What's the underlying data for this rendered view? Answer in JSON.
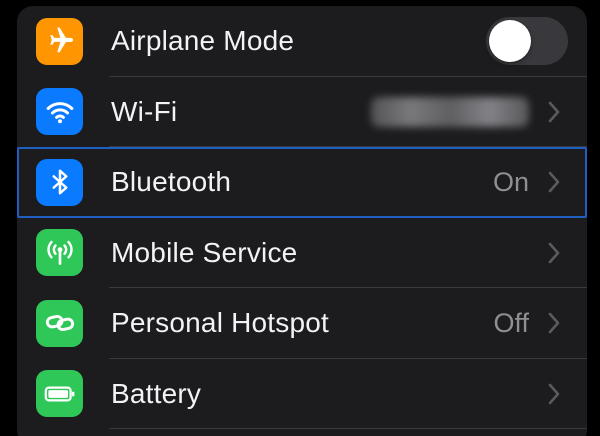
{
  "settings": {
    "rows": [
      {
        "label": "Airplane Mode",
        "icon": "airplane-icon",
        "icon_color": "#ff9500",
        "control": "toggle",
        "toggle_on": false
      },
      {
        "label": "Wi-Fi",
        "icon": "wifi-icon",
        "icon_color": "#0a7aff",
        "control": "chevron",
        "value_blurred": true
      },
      {
        "label": "Bluetooth",
        "icon": "bluetooth-icon",
        "icon_color": "#0a7aff",
        "control": "chevron",
        "value": "On",
        "selected": true
      },
      {
        "label": "Mobile Service",
        "icon": "antenna-icon",
        "icon_color": "#30c759",
        "control": "chevron"
      },
      {
        "label": "Personal Hotspot",
        "icon": "hotspot-link-icon",
        "icon_color": "#30c759",
        "control": "chevron",
        "value": "Off"
      },
      {
        "label": "Battery",
        "icon": "battery-icon",
        "icon_color": "#30c759",
        "control": "chevron"
      }
    ]
  },
  "colors": {
    "background": "#000000",
    "group_background": "#1c1c1e",
    "separator": "#3a3a3c",
    "label": "#f2f2f7",
    "secondary": "#8e8e93",
    "selection_outline": "#1f5fc2"
  }
}
